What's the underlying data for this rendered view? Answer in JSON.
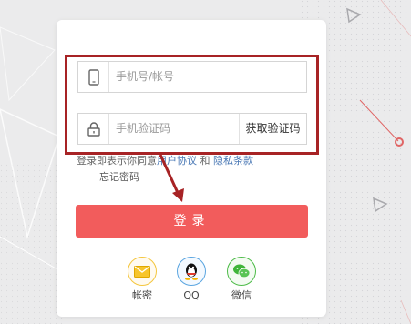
{
  "login": {
    "phone_placeholder": "手机号/帐号",
    "code_placeholder": "手机验证码",
    "get_code_label": "获取验证码",
    "agreement_prefix": "登录即表示你同意",
    "user_agreement": "用户协议",
    "and_word": " 和 ",
    "privacy_policy": "隐私条款",
    "forgot_password": "忘记密码",
    "login_button": "登录"
  },
  "social": [
    {
      "label": "帐密",
      "icon": "envelope-icon"
    },
    {
      "label": "QQ",
      "icon": "qq-penguin-icon"
    },
    {
      "label": "微信",
      "icon": "wechat-icon"
    }
  ],
  "colors": {
    "primary_button": "#f25c5c",
    "annotation_red": "#a72325",
    "link_blue": "#4a78b5",
    "background": "#e9e9ea"
  }
}
